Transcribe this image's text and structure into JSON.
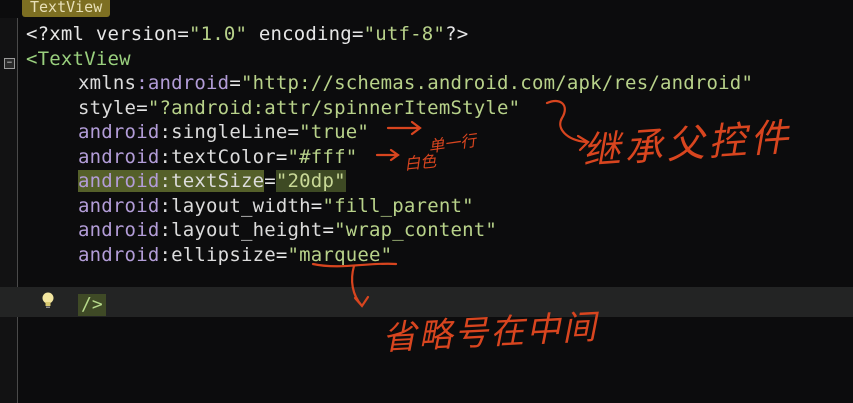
{
  "tab": {
    "title": "TextView"
  },
  "editor": {
    "lines": [
      {
        "kind": "decl",
        "open": "<?xml",
        "attr1": "version",
        "val1": "\"1.0\"",
        "attr2": "encoding",
        "val2": "\"utf-8\"",
        "close": "?>"
      },
      {
        "kind": "tag",
        "text": "<TextView"
      },
      {
        "ns": "xmlns",
        "name": ":android",
        "val": "\"http://schemas.android.com/apk/res/android\""
      },
      {
        "ns": "",
        "name": "style",
        "val": "\"?android:attr/spinnerItemStyle\""
      },
      {
        "ns": "android",
        "name": ":singleLine",
        "val": "\"true\""
      },
      {
        "ns": "android",
        "name": ":textColor",
        "val": "\"#fff\""
      },
      {
        "ns": "android",
        "name": ":textSize",
        "val": "\"20dp\""
      },
      {
        "ns": "android",
        "name": ":layout_width",
        "val": "\"fill_parent\""
      },
      {
        "ns": "android",
        "name": ":layout_height",
        "val": "\"wrap_content\""
      },
      {
        "ns": "android",
        "name": ":ellipsize",
        "val": "\"marquee\""
      }
    ],
    "closing_tag": "/>"
  },
  "annotations": {
    "single_line": "单一行",
    "white": "白色",
    "inherit_parent": "继承父控件",
    "ellipsis_middle": "省略号在中间"
  },
  "colors": {
    "background": "#0c0c0d",
    "tag": "#9ad07e",
    "namespace": "#b39dd8",
    "value": "#b8d28a",
    "ink": "#d8451f"
  },
  "icons": [
    "lightbulb-icon",
    "fold-toggle-icon"
  ]
}
